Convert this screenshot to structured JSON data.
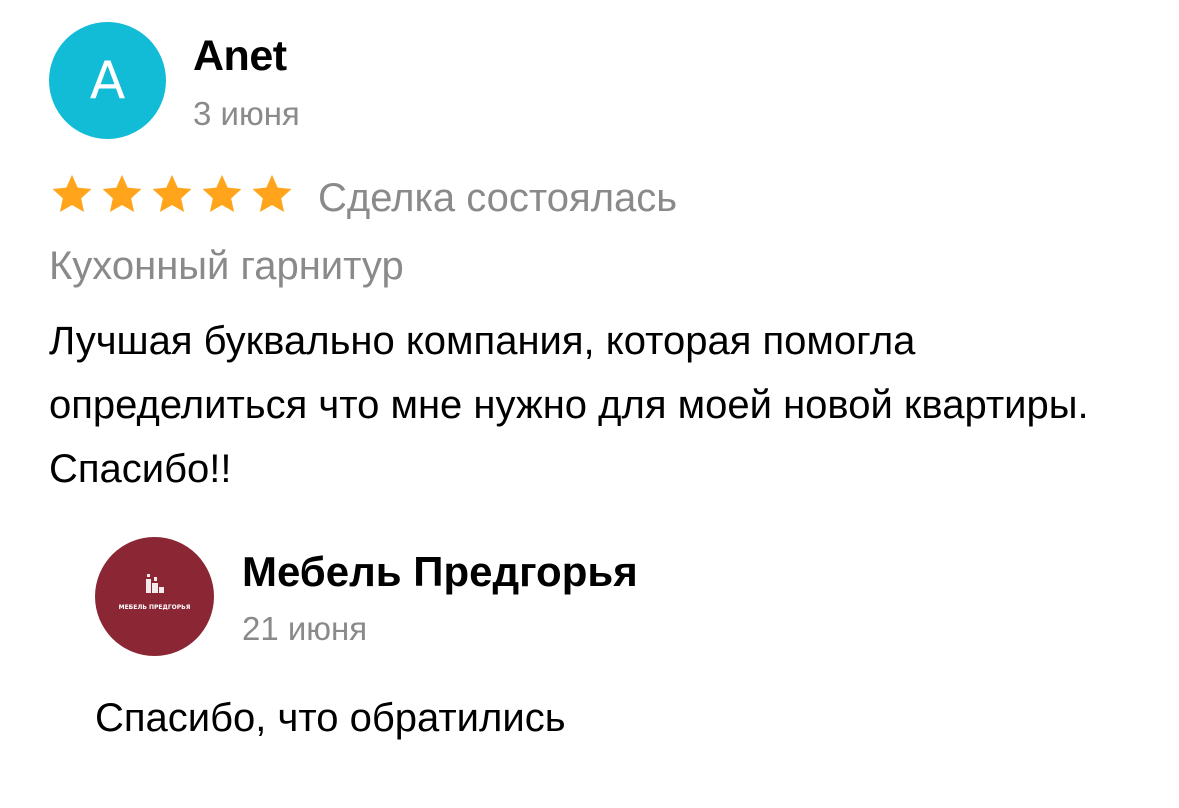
{
  "review": {
    "avatar_letter": "A",
    "avatar_color": "#12bcd6",
    "author": "Anet",
    "date": "3 июня",
    "rating": 5,
    "star_color": "#ffa41b",
    "deal_status": "Сделка состоялась",
    "product": "Кухонный гарнитур",
    "text": "Лучшая буквально компания, которая помогла определиться что мне нужно для моей новой квартиры. Спасибо!!"
  },
  "reply": {
    "avatar_color": "#8b2634",
    "logo_caption": "МЕБЕЛЬ ПРЕДГОРЬЯ",
    "author": "Мебель Предгорья",
    "date": "21 июня",
    "text": "Спасибо, что обратились"
  }
}
